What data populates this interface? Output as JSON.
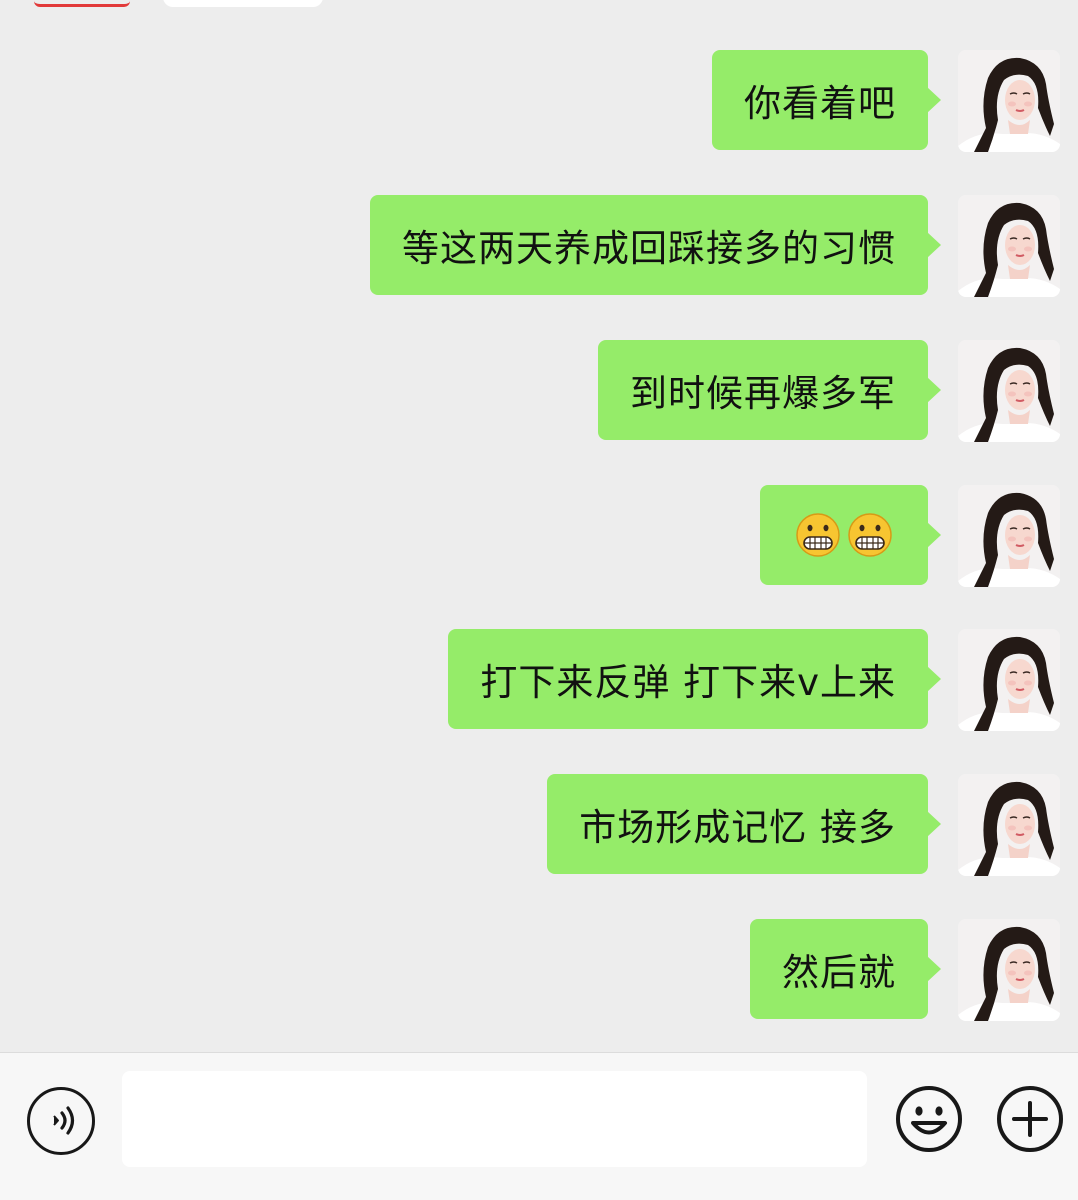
{
  "messages": [
    {
      "text": "你看着吧",
      "sender": "self"
    },
    {
      "text": "等这两天养成回踩接多的习惯",
      "sender": "self"
    },
    {
      "text": "到时候再爆多军",
      "sender": "self"
    },
    {
      "text": "",
      "sender": "self",
      "emojis": [
        "grimacing-face-emoji",
        "grimacing-face-emoji"
      ]
    },
    {
      "text": "打下来反弹 打下来v上来",
      "sender": "self"
    },
    {
      "text": "市场形成记忆 接多",
      "sender": "self"
    },
    {
      "text": "然后就",
      "sender": "self"
    }
  ],
  "input_bar": {
    "message_input_value": "",
    "message_input_placeholder": "",
    "voice_icon": "voice-icon",
    "emoji_icon": "smiley-icon",
    "more_icon": "plus-icon"
  },
  "colors": {
    "chat_background": "#ededed",
    "sent_bubble": "#95ec69",
    "input_bar_background": "#f7f7f7",
    "input_field": "#ffffff",
    "icon_stroke": "#181818"
  }
}
